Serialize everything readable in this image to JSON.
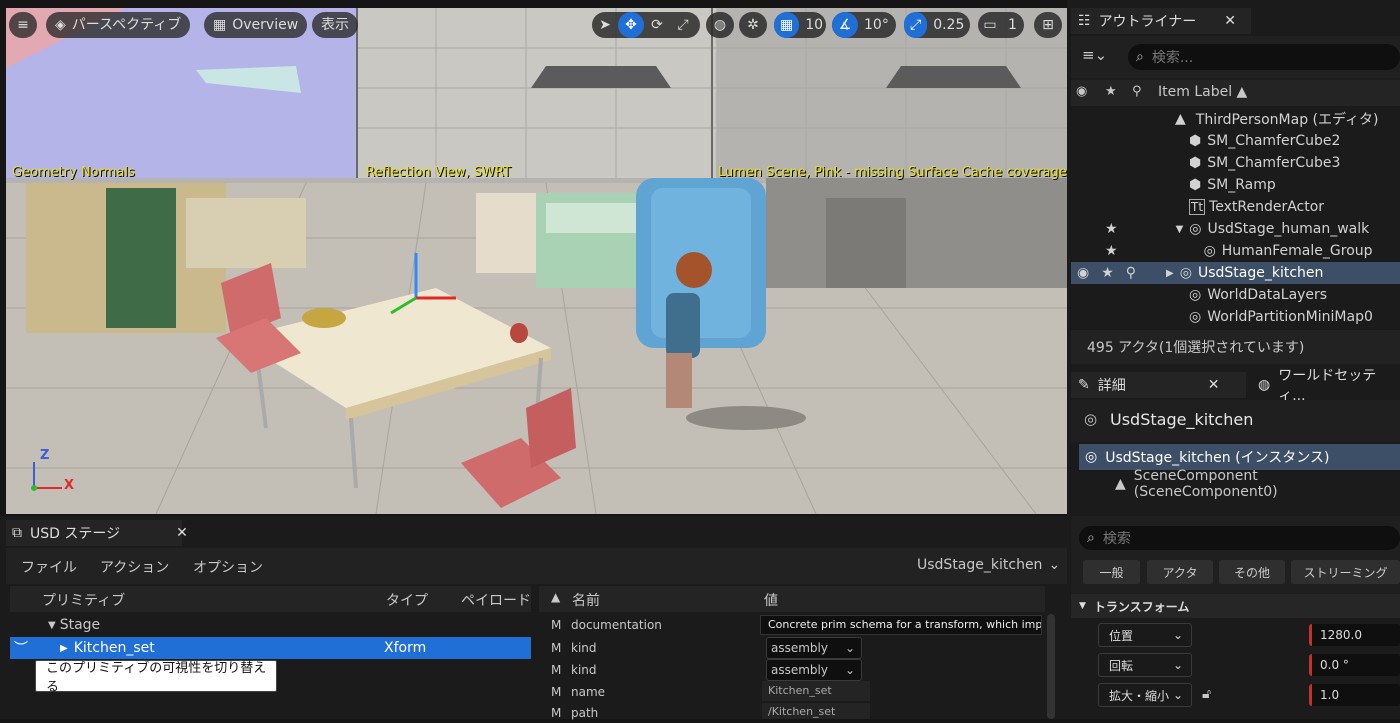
{
  "viewport": {
    "menu_icon": "hamburger-icon",
    "perspective_label": "パースペクティブ",
    "overview_label": "Overview",
    "show_label": "表示",
    "grid_snap_value": "10",
    "rotation_snap_value": "10°",
    "scale_snap_value": "0.25",
    "camera_speed_value": "1",
    "overlay_labels": [
      "Geometry Normals",
      "Reflection View, SWRT",
      "Lumen Scene, Pink - missing Surface Cache coverage"
    ],
    "axis_labels": {
      "z": "Z",
      "x": "X"
    }
  },
  "outliner": {
    "tab_title": "アウトライナー",
    "search_placeholder": "検索...",
    "column_label": "Item Label ▲",
    "items": [
      {
        "label": "ThirdPersonMap (エディタ)",
        "icon": "level-icon"
      },
      {
        "label": "SM_ChamferCube2",
        "icon": "static-mesh-icon"
      },
      {
        "label": "SM_ChamferCube3",
        "icon": "static-mesh-icon"
      },
      {
        "label": "SM_Ramp",
        "icon": "static-mesh-icon"
      },
      {
        "label": "TextRenderActor",
        "icon": "text-render-icon"
      },
      {
        "label": "UsdStage_human_walk",
        "icon": "usd-actor-icon"
      },
      {
        "label": "HumanFemale_Group",
        "icon": "usd-actor-icon"
      },
      {
        "label": "UsdStage_kitchen",
        "icon": "usd-actor-icon"
      },
      {
        "label": "WorldDataLayers",
        "icon": "usd-actor-icon"
      },
      {
        "label": "WorldPartitionMiniMap0",
        "icon": "usd-actor-icon"
      }
    ],
    "status": "495 アクタ(1個選択されています)"
  },
  "details": {
    "tab_title": "詳細",
    "world_tab_title": "ワールドセッティ...",
    "actor_name": "UsdStage_kitchen",
    "instance_label": "UsdStage_kitchen (インスタンス)",
    "component_label": "SceneComponent (SceneComponent0)",
    "search_placeholder": "検索",
    "filter_buttons": [
      "一般",
      "アクタ",
      "その他",
      "ストリーミング"
    ],
    "transform_header": "トランスフォーム",
    "location_label": "位置",
    "rotation_label": "回転",
    "scale_label": "拡大・縮小",
    "location_value": "1280.0",
    "rotation_value": "0.0 °",
    "scale_value": "1.0"
  },
  "usd_stage": {
    "tab_title": "USD ステージ",
    "menus": [
      "ファイル",
      "アクション",
      "オプション"
    ],
    "stage_selector": "UsdStage_kitchen",
    "tree_columns": [
      "プリミティブ",
      "タイプ",
      "ペイロード"
    ],
    "stage_node": "Stage",
    "selected_prim": "Kitchen_set",
    "selected_prim_type": "Xform",
    "tooltip": "このプリミティブの可視性を切り替える",
    "prop_columns": [
      "名前",
      "値"
    ],
    "properties": [
      {
        "flag": "M",
        "name": "documentation",
        "value": "Concrete prim schema for a transform, which impl"
      },
      {
        "flag": "M",
        "name": "kind",
        "value": "assembly"
      },
      {
        "flag": "M",
        "name": "kind",
        "value": "assembly"
      },
      {
        "flag": "M",
        "name": "name",
        "value": "Kitchen_set"
      },
      {
        "flag": "M",
        "name": "path",
        "value": "/Kitchen_set"
      }
    ]
  }
}
